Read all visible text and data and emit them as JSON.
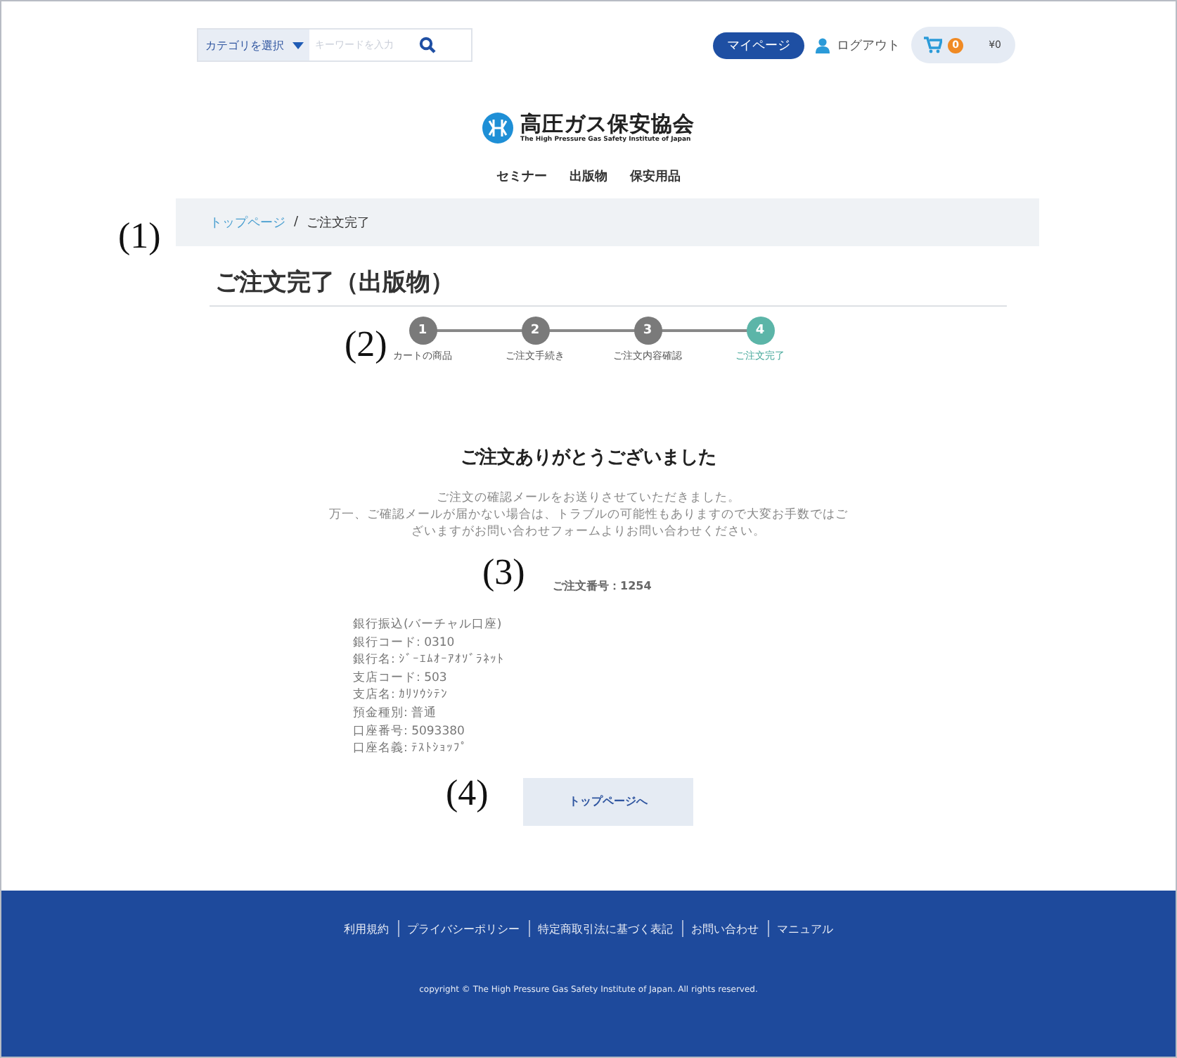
{
  "header": {
    "category_select": "カテゴリを選択",
    "search": {
      "placeholder": "キーワードを入力"
    },
    "mypage_button": "マイページ",
    "logout_link": "ログアウト",
    "cart": {
      "count": "0",
      "total": "¥0"
    }
  },
  "logo": {
    "name": "高圧ガス保安協会",
    "subtitle": "The High Pressure Gas Safety Institute of Japan"
  },
  "nav": [
    "セミナー",
    "出版物",
    "保安用品"
  ],
  "breadcrumb": [
    {
      "label": "トップページ",
      "kind": "link"
    },
    {
      "label": "/",
      "kind": "separator"
    },
    {
      "label": "ご注文完了",
      "kind": "current"
    }
  ],
  "page_title": "ご注文完了（出版物）",
  "steps": [
    {
      "number": "1",
      "label": "カートの商品",
      "selected": false
    },
    {
      "number": "2",
      "label": "ご注文手続き",
      "selected": false
    },
    {
      "number": "3",
      "label": "ご注文内容確認",
      "selected": false
    },
    {
      "number": "4",
      "label": "ご注文完了",
      "selected": true
    }
  ],
  "thanks": {
    "heading": "ご注文ありがとうございました",
    "message": [
      "ご注文の確認メールをお送りさせていただきました。",
      "万一、ご確認メールが届かない場合は、トラブルの可能性もありますので大変お手数ではございますがお問い合わせフォームよりお問い合わせください。"
    ]
  },
  "order_number": "ご注文番号：1254",
  "bank_info": [
    "銀行振込(バーチャル口座)",
    "銀行コード: 0310",
    "銀行名: ｼﾞｰｴﾑｵｰｱｵｿﾞﾗﾈｯﾄ",
    "支店コード: 503",
    "支店名: ｶﾘｿｳｼﾃﾝ",
    "預金種別: 普通",
    "口座番号: 5093380",
    "口座名義: ﾃｽﾄｼｮｯﾌﾟ"
  ],
  "top_button": "トップページへ",
  "annotations": [
    "(1)",
    "(2)",
    "(3)",
    "(4)"
  ],
  "footer": {
    "links": [
      "利用規約",
      "プライバシーポリシー",
      "特定商取引法に基づく表記",
      "お問い合わせ",
      "マニュアル"
    ],
    "copyright": "copyright © The High Pressure Gas Safety Institute of Japan. All rights reserved."
  }
}
